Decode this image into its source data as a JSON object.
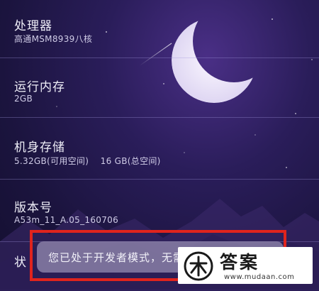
{
  "settings": [
    {
      "label": "处理器",
      "value": "高通MSM8939八核"
    },
    {
      "label": "运行内存",
      "value": "2GB"
    },
    {
      "label": "机身存储",
      "value": "5.32GB(可用空间)    16 GB(总空间)"
    },
    {
      "label": "版本号",
      "value": "A53m_11_A.05_160706"
    }
  ],
  "status_label": "状",
  "toast": {
    "text": "您已处于开发者模式，无需进行此操作"
  },
  "watermark": {
    "title": "答案",
    "url": "www.mudaan.com",
    "logo_icon": "mudaan-logo-icon"
  },
  "colors": {
    "highlight_frame": "#e0241d",
    "background": "#1b143e"
  }
}
